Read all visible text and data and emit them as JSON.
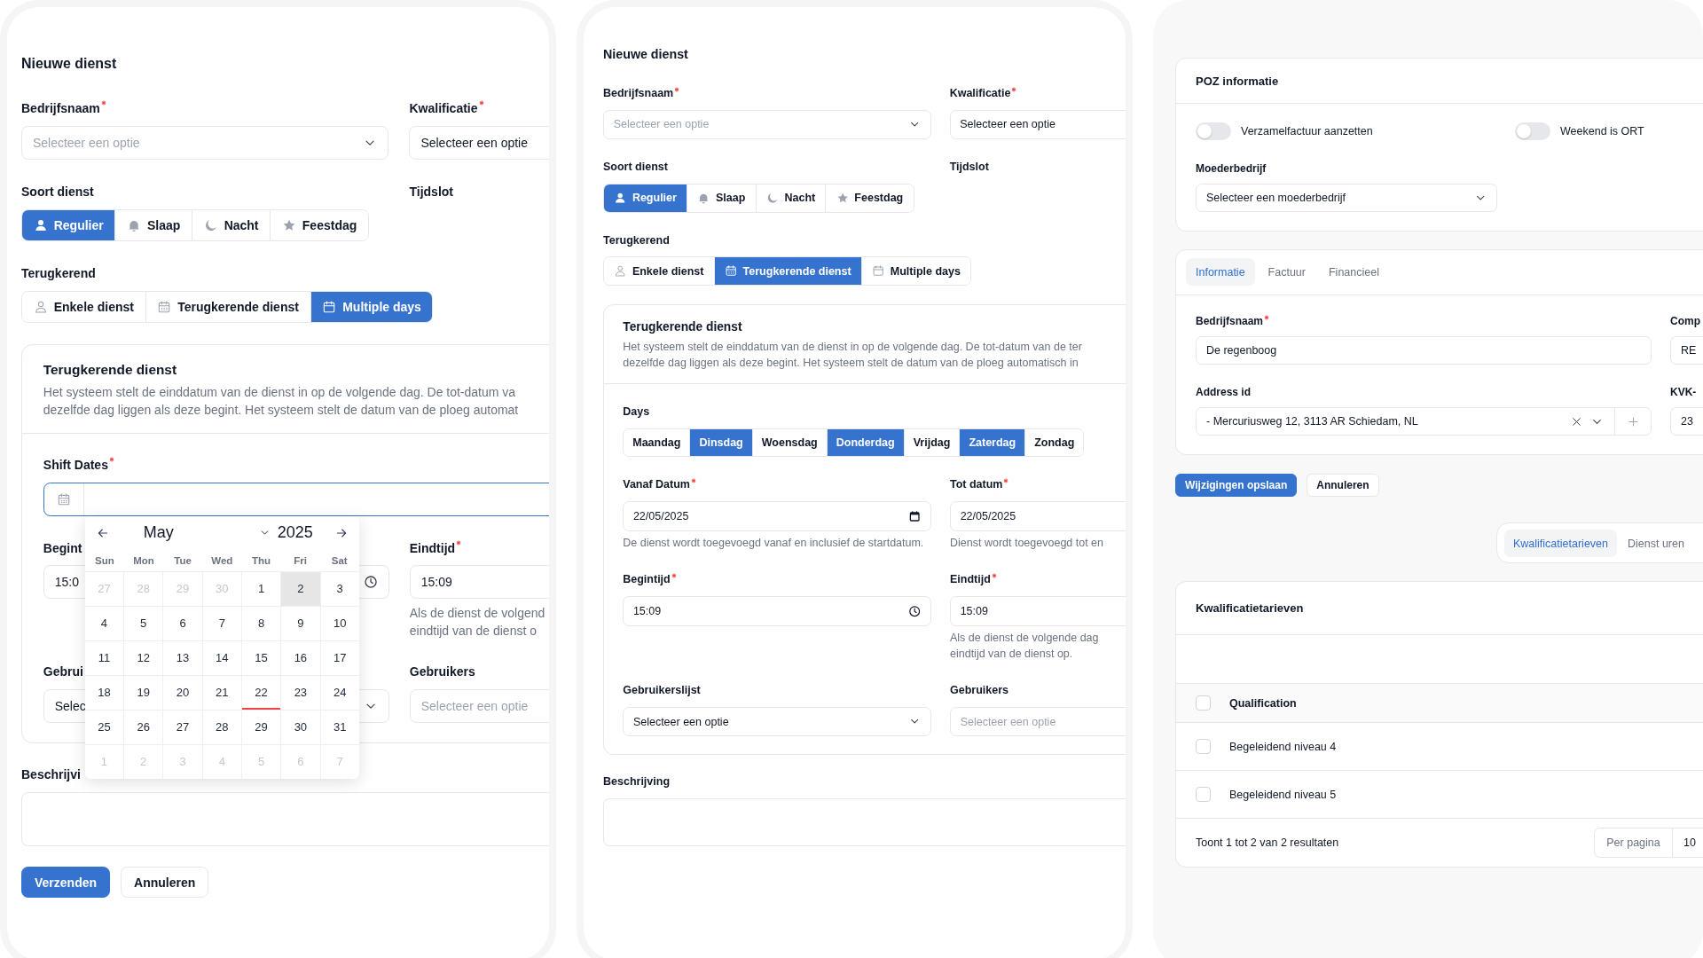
{
  "new_shift_a": {
    "title": "Nieuwe dienst",
    "company_field": {
      "label": "Bedrijfsnaam",
      "required": true,
      "placeholder": "Selecteer een optie"
    },
    "qualification_field": {
      "label": "Kwalificatie",
      "required": true,
      "value": "Selecteer een optie"
    },
    "shift_type": {
      "label": "Soort dienst",
      "options": [
        {
          "label": "Regulier",
          "selected": true
        },
        {
          "label": "Slaap",
          "selected": false
        },
        {
          "label": "Nacht",
          "selected": false
        },
        {
          "label": "Feestdag",
          "selected": false
        }
      ]
    },
    "timeslot": {
      "label": "Tijdslot"
    },
    "recurrence": {
      "label": "Terugkerend",
      "options": [
        {
          "label": "Enkele dienst",
          "selected": false
        },
        {
          "label": "Terugkerende dienst",
          "selected": false
        },
        {
          "label": "Multiple days",
          "selected": true
        }
      ]
    },
    "section": {
      "title": "Terugkerende dienst",
      "description_lines": [
        "Het systeem stelt de einddatum van de dienst in op de volgende dag. De tot-datum va",
        "dezelfde dag liggen als deze begint. Het systeem stelt de datum van de ploeg automat"
      ]
    },
    "shift_dates": {
      "label": "Shift Dates",
      "required": true
    },
    "calendar": {
      "month": "May",
      "year": "2025",
      "weekdays": [
        "Sun",
        "Mon",
        "Tue",
        "Wed",
        "Thu",
        "Fri",
        "Sat"
      ],
      "days": [
        {
          "day": "27",
          "outside": true,
          "selected": false,
          "today": false
        },
        {
          "day": "28",
          "outside": true,
          "selected": false,
          "today": false
        },
        {
          "day": "29",
          "outside": true,
          "selected": false,
          "today": false
        },
        {
          "day": "30",
          "outside": true,
          "selected": false,
          "today": false
        },
        {
          "day": "1",
          "outside": false,
          "selected": false,
          "today": false
        },
        {
          "day": "2",
          "outside": false,
          "selected": true,
          "today": false
        },
        {
          "day": "3",
          "outside": false,
          "selected": false,
          "today": false
        },
        {
          "day": "4",
          "outside": false,
          "selected": false,
          "today": false
        },
        {
          "day": "5",
          "outside": false,
          "selected": false,
          "today": false
        },
        {
          "day": "6",
          "outside": false,
          "selected": false,
          "today": false
        },
        {
          "day": "7",
          "outside": false,
          "selected": false,
          "today": false
        },
        {
          "day": "8",
          "outside": false,
          "selected": false,
          "today": false
        },
        {
          "day": "9",
          "outside": false,
          "selected": false,
          "today": false
        },
        {
          "day": "10",
          "outside": false,
          "selected": false,
          "today": false
        },
        {
          "day": "11",
          "outside": false,
          "selected": false,
          "today": false
        },
        {
          "day": "12",
          "outside": false,
          "selected": false,
          "today": false
        },
        {
          "day": "13",
          "outside": false,
          "selected": false,
          "today": false
        },
        {
          "day": "14",
          "outside": false,
          "selected": false,
          "today": false
        },
        {
          "day": "15",
          "outside": false,
          "selected": false,
          "today": false
        },
        {
          "day": "16",
          "outside": false,
          "selected": false,
          "today": false
        },
        {
          "day": "17",
          "outside": false,
          "selected": false,
          "today": false
        },
        {
          "day": "18",
          "outside": false,
          "selected": false,
          "today": false
        },
        {
          "day": "19",
          "outside": false,
          "selected": false,
          "today": false
        },
        {
          "day": "20",
          "outside": false,
          "selected": false,
          "today": false
        },
        {
          "day": "21",
          "outside": false,
          "selected": false,
          "today": false
        },
        {
          "day": "22",
          "outside": false,
          "selected": false,
          "today": true
        },
        {
          "day": "23",
          "outside": false,
          "selected": false,
          "today": false
        },
        {
          "day": "24",
          "outside": false,
          "selected": false,
          "today": false
        },
        {
          "day": "25",
          "outside": false,
          "selected": false,
          "today": false
        },
        {
          "day": "26",
          "outside": false,
          "selected": false,
          "today": false
        },
        {
          "day": "27",
          "outside": false,
          "selected": false,
          "today": false
        },
        {
          "day": "28",
          "outside": false,
          "selected": false,
          "today": false
        },
        {
          "day": "29",
          "outside": false,
          "selected": false,
          "today": false
        },
        {
          "day": "30",
          "outside": false,
          "selected": false,
          "today": false
        },
        {
          "day": "31",
          "outside": false,
          "selected": false,
          "today": false
        },
        {
          "day": "1",
          "outside": true,
          "selected": false,
          "today": false
        },
        {
          "day": "2",
          "outside": true,
          "selected": false,
          "today": false
        },
        {
          "day": "3",
          "outside": true,
          "selected": false,
          "today": false
        },
        {
          "day": "4",
          "outside": true,
          "selected": false,
          "today": false
        },
        {
          "day": "5",
          "outside": true,
          "selected": false,
          "today": false
        },
        {
          "day": "6",
          "outside": true,
          "selected": false,
          "today": false
        },
        {
          "day": "7",
          "outside": true,
          "selected": false,
          "today": false
        }
      ]
    },
    "start_time": {
      "label": "Begint",
      "value": "15:0"
    },
    "end_time": {
      "label": "Eindtijd",
      "required": true,
      "value": "15:09",
      "hint_lines": [
        "Als de dienst de volgend",
        "eindtijd van de dienst o"
      ]
    },
    "user_list": {
      "label": "Gebrui",
      "value": "Selec"
    },
    "users": {
      "label": "Gebruikers",
      "placeholder": "Selecteer een optie"
    },
    "description": {
      "label": "Beschrijvi"
    },
    "buttons": [
      {
        "label": "Verzenden",
        "kind": "primary"
      },
      {
        "label": "Annuleren",
        "kind": "secondary"
      }
    ]
  },
  "new_shift_b": {
    "title": "Nieuwe dienst",
    "company_field": {
      "label": "Bedrijfsnaam",
      "required": true,
      "placeholder": "Selecteer een optie"
    },
    "qualification_field": {
      "label": "Kwalificatie",
      "required": true,
      "value": "Selecteer een optie"
    },
    "shift_type": {
      "label": "Soort dienst",
      "options": [
        {
          "label": "Regulier",
          "selected": true
        },
        {
          "label": "Slaap",
          "selected": false
        },
        {
          "label": "Nacht",
          "selected": false
        },
        {
          "label": "Feestdag",
          "selected": false
        }
      ]
    },
    "timeslot": {
      "label": "Tijdslot"
    },
    "recurrence": {
      "label": "Terugkerend",
      "options": [
        {
          "label": "Enkele dienst",
          "selected": false
        },
        {
          "label": "Terugkerende dienst",
          "selected": true
        },
        {
          "label": "Multiple days",
          "selected": false
        }
      ]
    },
    "section": {
      "title": "Terugkerende dienst",
      "description_lines": [
        "Het systeem stelt de einddatum van de dienst in op de volgende dag. De tot-datum van de ter",
        "dezelfde dag liggen als deze begint. Het systeem stelt de datum van de ploeg automatisch in"
      ]
    },
    "days": {
      "label": "Days",
      "options": [
        {
          "label": "Maandag",
          "selected": false
        },
        {
          "label": "Dinsdag",
          "selected": true
        },
        {
          "label": "Woensdag",
          "selected": false
        },
        {
          "label": "Donderdag",
          "selected": true
        },
        {
          "label": "Vrijdag",
          "selected": false
        },
        {
          "label": "Zaterdag",
          "selected": true
        },
        {
          "label": "Zondag",
          "selected": false
        }
      ]
    },
    "from_date": {
      "label": "Vanaf Datum",
      "required": true,
      "value": "22/05/2025",
      "hint": "De dienst wordt toegevoegd vanaf en inclusief de startdatum."
    },
    "to_date": {
      "label": "Tot datum",
      "required": true,
      "value": "22/05/2025",
      "hint": "Dienst wordt toegevoegd tot en"
    },
    "start_time": {
      "label": "Begintijd",
      "required": true,
      "value": "15:09"
    },
    "end_time": {
      "label": "Eindtijd",
      "required": true,
      "value": "15:09",
      "hint_lines": [
        "Als de dienst de volgende dag",
        "eindtijd van de dienst op."
      ]
    },
    "user_list": {
      "label": "Gebruikerslijst",
      "value": "Selecteer een optie"
    },
    "users": {
      "label": "Gebruikers",
      "placeholder": "Selecteer een optie"
    },
    "description": {
      "label": "Beschrijving"
    }
  },
  "company": {
    "poz": {
      "title": "POZ informatie",
      "toggles": [
        {
          "label": "Verzamelfactuur aanzetten",
          "on": false
        },
        {
          "label": "Weekend is ORT",
          "on": false
        }
      ],
      "parent_field": {
        "label": "Moederbedrijf",
        "value": "Selecteer een moederbedrijf"
      }
    },
    "tabs": [
      {
        "label": "Informatie",
        "selected": true
      },
      {
        "label": "Factuur",
        "selected": false
      },
      {
        "label": "Financieel",
        "selected": false
      }
    ],
    "name_field": {
      "label": "Bedrijfsnaam",
      "required": true,
      "value": "De regenboog"
    },
    "column_2_field": {
      "label": "Comp",
      "value": "RE"
    },
    "address_field": {
      "label": "Address id",
      "value": "- Mercuriusweg 12, 3113 AR Schiedam, NL"
    },
    "column_2_field_b": {
      "label": "KVK-",
      "value": "23"
    },
    "actions": [
      {
        "label": "Wijzigingen opslaan",
        "kind": "primary"
      },
      {
        "label": "Annuleren",
        "kind": "secondary"
      }
    ],
    "section_tabs": [
      {
        "label": "Kwalificatietarieven",
        "selected": true
      },
      {
        "label": "Dienst uren",
        "selected": false
      }
    ],
    "table": {
      "title": "Kwalificatietarieven",
      "header": {
        "label": "Qualification",
        "checked": false
      },
      "rows": [
        {
          "label": "Begeleidend niveau 4",
          "checked": false
        },
        {
          "label": "Begeleidend niveau 5",
          "checked": false
        }
      ],
      "summary": "Toont 1 tot 2 van 2 resultaten",
      "per_page": {
        "label": "Per pagina",
        "value": "10"
      }
    }
  }
}
